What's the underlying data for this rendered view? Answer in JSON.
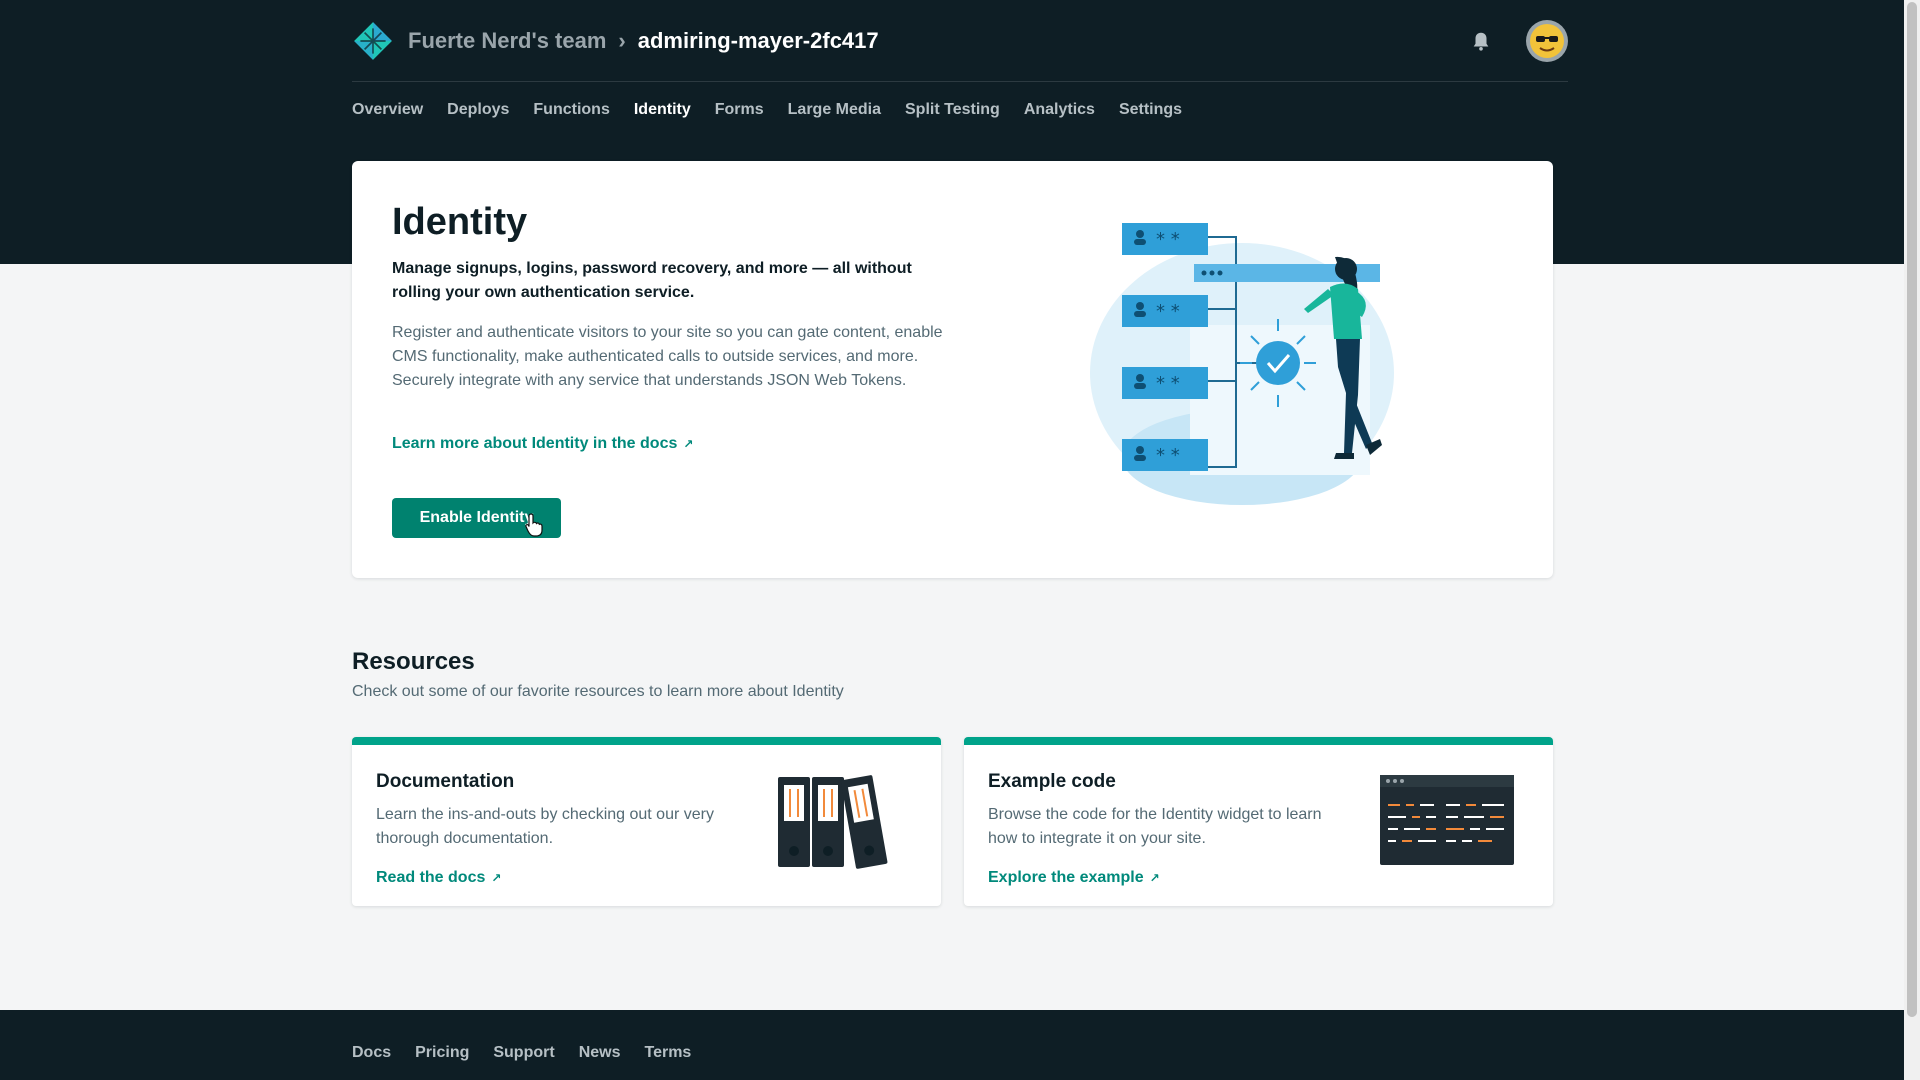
{
  "header": {
    "team_name": "Fuerte Nerd's team",
    "separator": "›",
    "site_name": "admiring-mayer-2fc417"
  },
  "nav": {
    "items": [
      {
        "label": "Overview",
        "active": false
      },
      {
        "label": "Deploys",
        "active": false
      },
      {
        "label": "Functions",
        "active": false
      },
      {
        "label": "Identity",
        "active": true
      },
      {
        "label": "Forms",
        "active": false
      },
      {
        "label": "Large Media",
        "active": false
      },
      {
        "label": "Split Testing",
        "active": false
      },
      {
        "label": "Analytics",
        "active": false
      },
      {
        "label": "Settings",
        "active": false
      }
    ]
  },
  "identity": {
    "title": "Identity",
    "lead": "Manage signups, logins, password recovery, and more — all without rolling your own authentication service.",
    "description": "Register and authenticate visitors to your site so you can gate content, enable CMS functionality, make authenticated calls to outside services, and more. Securely integrate with any service that understands JSON Web Tokens.",
    "docs_link": "Learn more about Identity in the docs",
    "external_glyph": "↗",
    "enable_button": "Enable Identity"
  },
  "resources": {
    "title": "Resources",
    "subtitle": "Check out some of our favorite resources to learn more about Identity",
    "cards": [
      {
        "title": "Documentation",
        "description": "Learn the ins-and-outs by checking out our very thorough documentation.",
        "link": "Read the docs",
        "icon": "binders-icon"
      },
      {
        "title": "Example code",
        "description": "Browse the code for the Identity widget to learn how to integrate it on your site.",
        "link": "Explore the example",
        "icon": "code-window-icon"
      }
    ]
  },
  "footer": {
    "links": [
      "Docs",
      "Pricing",
      "Support",
      "News",
      "Terms"
    ]
  },
  "colors": {
    "header_bg": "#0e1e25",
    "accent": "#00897b",
    "button": "#00826f",
    "card_stripe": "#00a38a",
    "illustration_blue": "#2f9fd8"
  }
}
